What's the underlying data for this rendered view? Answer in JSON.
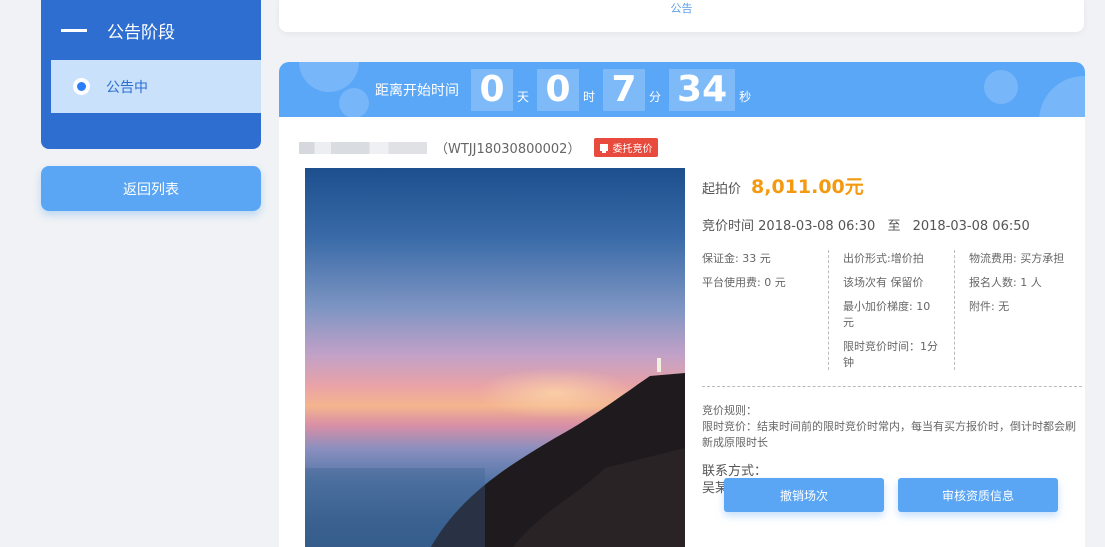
{
  "sidebar": {
    "section_title": "公告阶段",
    "items": [
      {
        "label": "公告中",
        "selected": true
      }
    ],
    "back_label": "返回列表"
  },
  "top_card": {
    "notice_text": "公告"
  },
  "countdown": {
    "label": "距离开始时间",
    "days": "0",
    "days_unit": "天",
    "hours": "0",
    "hours_unit": "时",
    "minutes": "7",
    "minutes_unit": "分",
    "seconds": "34",
    "seconds_unit": "秒"
  },
  "lot": {
    "code": "（WTJJ18030800002）",
    "tag": "委托竞价"
  },
  "details": {
    "start_price_label": "起拍价",
    "start_price": "8,011.00元",
    "bid_time_label": "竞价时间",
    "bid_start": "2018-03-08 06:30",
    "bid_to": "至",
    "bid_end": "2018-03-08 06:50",
    "col1": [
      "保证金:  33  元",
      "平台使用费:  0  元"
    ],
    "col2": [
      "出价形式:增价拍",
      "该场次有 保留价",
      "最小加价梯度: 10元",
      "限时竞价时间：1分钟"
    ],
    "col3": [
      "物流费用:  买方承担",
      "报名人数:  1  人",
      "附件: 无"
    ],
    "rules_title": "竞价规则：",
    "rules_text": "限时竞价：结束时间前的限时竞价时常内，每当有买方报价时，倒计时都会刷新成原限时长",
    "contact_title": "联系方式：",
    "contact_name": "吴某",
    "contact_phone": "13311111111"
  },
  "actions": {
    "cancel_label": "撤销场次",
    "review_label": "审核资质信息"
  },
  "colors": {
    "primary": "#2d6ed0",
    "banner": "#5aa6f7",
    "button": "#5ba6f4",
    "price": "#f39a11",
    "tag": "#e84a3d"
  },
  "icons": [
    "dash-icon",
    "radio-selected-icon",
    "auction-tag-icon"
  ]
}
